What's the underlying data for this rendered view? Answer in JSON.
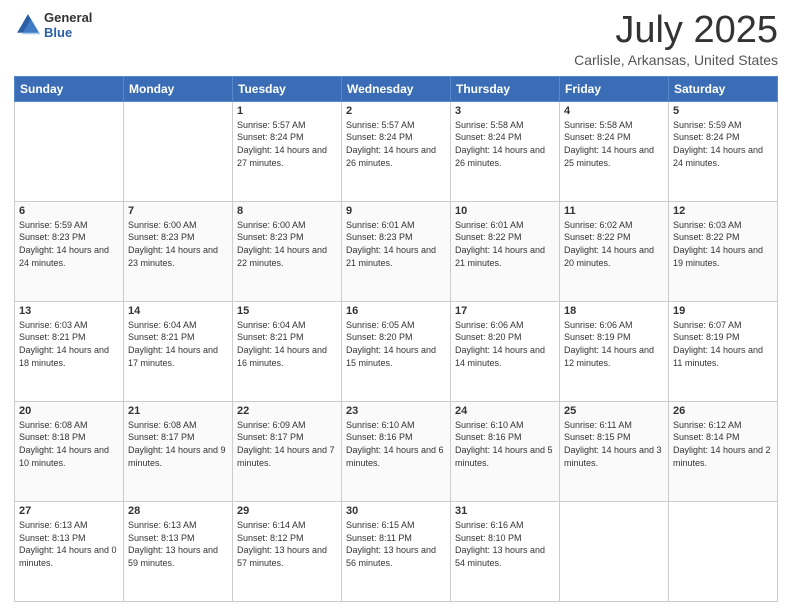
{
  "logo": {
    "general": "General",
    "blue": "Blue"
  },
  "header": {
    "month": "July 2025",
    "location": "Carlisle, Arkansas, United States"
  },
  "weekdays": [
    "Sunday",
    "Monday",
    "Tuesday",
    "Wednesday",
    "Thursday",
    "Friday",
    "Saturday"
  ],
  "weeks": [
    [
      {
        "day": "",
        "detail": ""
      },
      {
        "day": "",
        "detail": ""
      },
      {
        "day": "1",
        "detail": "Sunrise: 5:57 AM\nSunset: 8:24 PM\nDaylight: 14 hours and 27 minutes."
      },
      {
        "day": "2",
        "detail": "Sunrise: 5:57 AM\nSunset: 8:24 PM\nDaylight: 14 hours and 26 minutes."
      },
      {
        "day": "3",
        "detail": "Sunrise: 5:58 AM\nSunset: 8:24 PM\nDaylight: 14 hours and 26 minutes."
      },
      {
        "day": "4",
        "detail": "Sunrise: 5:58 AM\nSunset: 8:24 PM\nDaylight: 14 hours and 25 minutes."
      },
      {
        "day": "5",
        "detail": "Sunrise: 5:59 AM\nSunset: 8:24 PM\nDaylight: 14 hours and 24 minutes."
      }
    ],
    [
      {
        "day": "6",
        "detail": "Sunrise: 5:59 AM\nSunset: 8:23 PM\nDaylight: 14 hours and 24 minutes."
      },
      {
        "day": "7",
        "detail": "Sunrise: 6:00 AM\nSunset: 8:23 PM\nDaylight: 14 hours and 23 minutes."
      },
      {
        "day": "8",
        "detail": "Sunrise: 6:00 AM\nSunset: 8:23 PM\nDaylight: 14 hours and 22 minutes."
      },
      {
        "day": "9",
        "detail": "Sunrise: 6:01 AM\nSunset: 8:23 PM\nDaylight: 14 hours and 21 minutes."
      },
      {
        "day": "10",
        "detail": "Sunrise: 6:01 AM\nSunset: 8:22 PM\nDaylight: 14 hours and 21 minutes."
      },
      {
        "day": "11",
        "detail": "Sunrise: 6:02 AM\nSunset: 8:22 PM\nDaylight: 14 hours and 20 minutes."
      },
      {
        "day": "12",
        "detail": "Sunrise: 6:03 AM\nSunset: 8:22 PM\nDaylight: 14 hours and 19 minutes."
      }
    ],
    [
      {
        "day": "13",
        "detail": "Sunrise: 6:03 AM\nSunset: 8:21 PM\nDaylight: 14 hours and 18 minutes."
      },
      {
        "day": "14",
        "detail": "Sunrise: 6:04 AM\nSunset: 8:21 PM\nDaylight: 14 hours and 17 minutes."
      },
      {
        "day": "15",
        "detail": "Sunrise: 6:04 AM\nSunset: 8:21 PM\nDaylight: 14 hours and 16 minutes."
      },
      {
        "day": "16",
        "detail": "Sunrise: 6:05 AM\nSunset: 8:20 PM\nDaylight: 14 hours and 15 minutes."
      },
      {
        "day": "17",
        "detail": "Sunrise: 6:06 AM\nSunset: 8:20 PM\nDaylight: 14 hours and 14 minutes."
      },
      {
        "day": "18",
        "detail": "Sunrise: 6:06 AM\nSunset: 8:19 PM\nDaylight: 14 hours and 12 minutes."
      },
      {
        "day": "19",
        "detail": "Sunrise: 6:07 AM\nSunset: 8:19 PM\nDaylight: 14 hours and 11 minutes."
      }
    ],
    [
      {
        "day": "20",
        "detail": "Sunrise: 6:08 AM\nSunset: 8:18 PM\nDaylight: 14 hours and 10 minutes."
      },
      {
        "day": "21",
        "detail": "Sunrise: 6:08 AM\nSunset: 8:17 PM\nDaylight: 14 hours and 9 minutes."
      },
      {
        "day": "22",
        "detail": "Sunrise: 6:09 AM\nSunset: 8:17 PM\nDaylight: 14 hours and 7 minutes."
      },
      {
        "day": "23",
        "detail": "Sunrise: 6:10 AM\nSunset: 8:16 PM\nDaylight: 14 hours and 6 minutes."
      },
      {
        "day": "24",
        "detail": "Sunrise: 6:10 AM\nSunset: 8:16 PM\nDaylight: 14 hours and 5 minutes."
      },
      {
        "day": "25",
        "detail": "Sunrise: 6:11 AM\nSunset: 8:15 PM\nDaylight: 14 hours and 3 minutes."
      },
      {
        "day": "26",
        "detail": "Sunrise: 6:12 AM\nSunset: 8:14 PM\nDaylight: 14 hours and 2 minutes."
      }
    ],
    [
      {
        "day": "27",
        "detail": "Sunrise: 6:13 AM\nSunset: 8:13 PM\nDaylight: 14 hours and 0 minutes."
      },
      {
        "day": "28",
        "detail": "Sunrise: 6:13 AM\nSunset: 8:13 PM\nDaylight: 13 hours and 59 minutes."
      },
      {
        "day": "29",
        "detail": "Sunrise: 6:14 AM\nSunset: 8:12 PM\nDaylight: 13 hours and 57 minutes."
      },
      {
        "day": "30",
        "detail": "Sunrise: 6:15 AM\nSunset: 8:11 PM\nDaylight: 13 hours and 56 minutes."
      },
      {
        "day": "31",
        "detail": "Sunrise: 6:16 AM\nSunset: 8:10 PM\nDaylight: 13 hours and 54 minutes."
      },
      {
        "day": "",
        "detail": ""
      },
      {
        "day": "",
        "detail": ""
      }
    ]
  ]
}
